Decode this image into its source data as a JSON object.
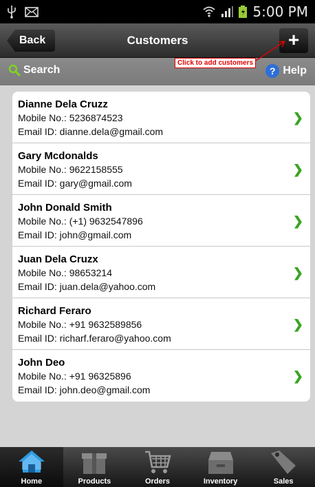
{
  "status_bar": {
    "time": "5:00 PM"
  },
  "header": {
    "back_label": "Back",
    "title": "Customers",
    "add_label": "+"
  },
  "search_bar": {
    "search_label": "Search",
    "help_label": "Help",
    "help_icon": "?"
  },
  "annotation": {
    "text": "Click to add customers"
  },
  "customers": [
    {
      "name": "Dianne Dela Cruzz",
      "mobile": "Mobile No.: 5236874523",
      "email": "Email ID: dianne.dela@gmail.com"
    },
    {
      "name": "Gary Mcdonalds",
      "mobile": "Mobile No.: 9622158555",
      "email": "Email ID: gary@gmail.com"
    },
    {
      "name": "John Donald Smith",
      "mobile": "Mobile No.: (+1) 9632547896",
      "email": "Email ID: john@gmail.com"
    },
    {
      "name": "Juan Dela Cruzx",
      "mobile": "Mobile No.: 98653214",
      "email": "Email ID: juan.dela@yahoo.com"
    },
    {
      "name": "Richard  Feraro",
      "mobile": "Mobile No.: +91 9632589856",
      "email": "Email ID: richarf.feraro@yahoo.com"
    },
    {
      "name": "John  Deo",
      "mobile": "Mobile No.: +91 96325896",
      "email": "Email ID: john.deo@gmail.com"
    }
  ],
  "tabs": [
    {
      "label": "Home",
      "icon": "home-icon"
    },
    {
      "label": "Products",
      "icon": "products-icon"
    },
    {
      "label": "Orders",
      "icon": "cart-icon"
    },
    {
      "label": "Inventory",
      "icon": "inventory-icon"
    },
    {
      "label": "Sales",
      "icon": "tag-icon"
    }
  ],
  "colors": {
    "accent_green": "#3aa521",
    "annotation_red": "#e00000",
    "help_blue": "#2d6fd8",
    "home_blue": "#2e9be0"
  }
}
